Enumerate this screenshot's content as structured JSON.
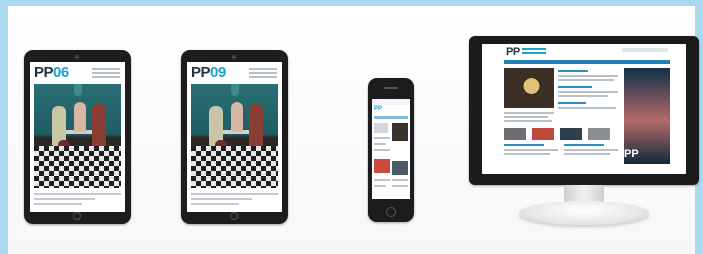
{
  "frame": {
    "border_color": "#a9daf0"
  },
  "tablets": [
    {
      "masthead_pp": "PP",
      "masthead_num": "06"
    },
    {
      "masthead_pp": "PP",
      "masthead_num": "09"
    }
  ],
  "phone": {
    "logo": "PP"
  },
  "monitor": {
    "logo": "PP",
    "side_logo": "PP"
  },
  "colors": {
    "accent": "#1ca4c8",
    "dark": "#1f3340",
    "device": "#1d1d1f"
  }
}
